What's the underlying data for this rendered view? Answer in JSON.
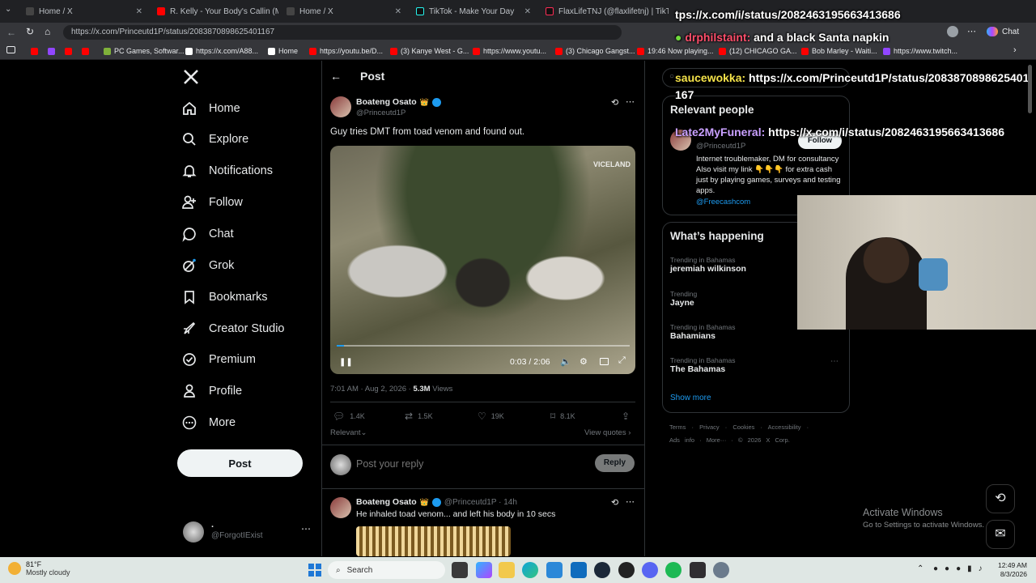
{
  "browser": {
    "tabs": [
      {
        "title": "Home / X",
        "fav": "#444"
      },
      {
        "title": "R. Kelly - Your Body's Callin (Medi",
        "fav": "#ff0000"
      },
      {
        "title": "Home / X",
        "fav": "#444"
      },
      {
        "title": "TikTok - Make Your Day",
        "fav": "#111"
      },
      {
        "title": "FlaxLifeTNJ (@flaxlifetnj) | TikTok",
        "fav": "#111"
      }
    ],
    "url": "https://x.com/Princeutd1P/status/2083870898625401167",
    "copilot_label": "Chat",
    "bookmarks": [
      "PC Games, Softwar...",
      "https://x.com/A88...",
      "Home",
      "https://youtu.be/D...",
      "(3) Kanye West - G...",
      "https://www.youtu...",
      "(3) Chicago Gangst...",
      "19:46 Now playing...",
      "(12) CHICAGO GA...",
      "Bob Marley - Waiti...",
      "https://www.twitch..."
    ]
  },
  "sidebar": {
    "nav": [
      "Home",
      "Explore",
      "Notifications",
      "Follow",
      "Chat",
      "Grok",
      "Bookmarks",
      "Creator Studio",
      "Premium",
      "Profile",
      "More"
    ],
    "post_button": "Post",
    "account_name": ".",
    "account_handle": "@ForgotIExist"
  },
  "post": {
    "header": "Post",
    "author": "Boateng Osato",
    "badge": "👑",
    "handle": "@Princeutd1P",
    "text": "Guy tries DMT from toad venom and found out.",
    "video_watermark": "VICELAND",
    "video_time": "0:03 / 2:06",
    "video_progress": 0.024,
    "timestamp": "7:01 AM · Aug 2, 2026 · ",
    "views": "5.3M",
    "views_label": " Views",
    "replies": "1.4K",
    "reposts": "1.5K",
    "likes": "19K",
    "bookmarks": "8.1K",
    "sort_label": "Relevant",
    "view_quotes": "View quotes",
    "reply_placeholder": "Post your reply",
    "reply_button": "Reply"
  },
  "reply": {
    "author": "Boateng Osato",
    "badge": "👑",
    "handle_time": "@Princeutd1P · 14h",
    "text": "He inhaled toad venom... and left his body in 10 secs"
  },
  "right": {
    "relevant_title": "Relevant people",
    "person_handle": "@Princeutd1P",
    "follow_label": "Follow",
    "bio": "Internet troublemaker, DM for consultancy Also visit my link 👇👇👇 for extra cash just by playing games, surveys and testing apps.",
    "bio_link": "@Freecashcom",
    "happening_title": "What’s happening",
    "trends": [
      {
        "sub": "Trending in Bahamas",
        "name": "jeremiah wilkinson"
      },
      {
        "sub": "Trending",
        "name": "Jayne"
      },
      {
        "sub": "Trending in Bahamas",
        "name": "Bahamians"
      },
      {
        "sub": "Trending in Bahamas",
        "name": "The Bahamas"
      }
    ],
    "show_more": "Show more",
    "footer1": "Terms · Privacy · Cookies · Accessibility ·",
    "footer2": "Ads info · More··· · © 2026 X Corp."
  },
  "chat_overlay": {
    "line0": "tps://x.com/i/status/2082463195663413686",
    "msg1_user": "drphilstaint:",
    "msg1_text": " and a black Santa napkin",
    "msg2_user": "saucewokka:",
    "msg2_text": " https://x.com/Princeutd1P/status/2083870898625401167",
    "msg3_user": "Late2MyFuneral:",
    "msg3_text": " https://x.com/i/status/2082463195663413686"
  },
  "watermark": {
    "title": "Activate Windows",
    "sub": "Go to Settings to activate Windows."
  },
  "taskbar": {
    "temp": "81°F",
    "weather": "Mostly cloudy",
    "search": "Search",
    "time": "12:49 AM",
    "date": "8/3/2026"
  }
}
